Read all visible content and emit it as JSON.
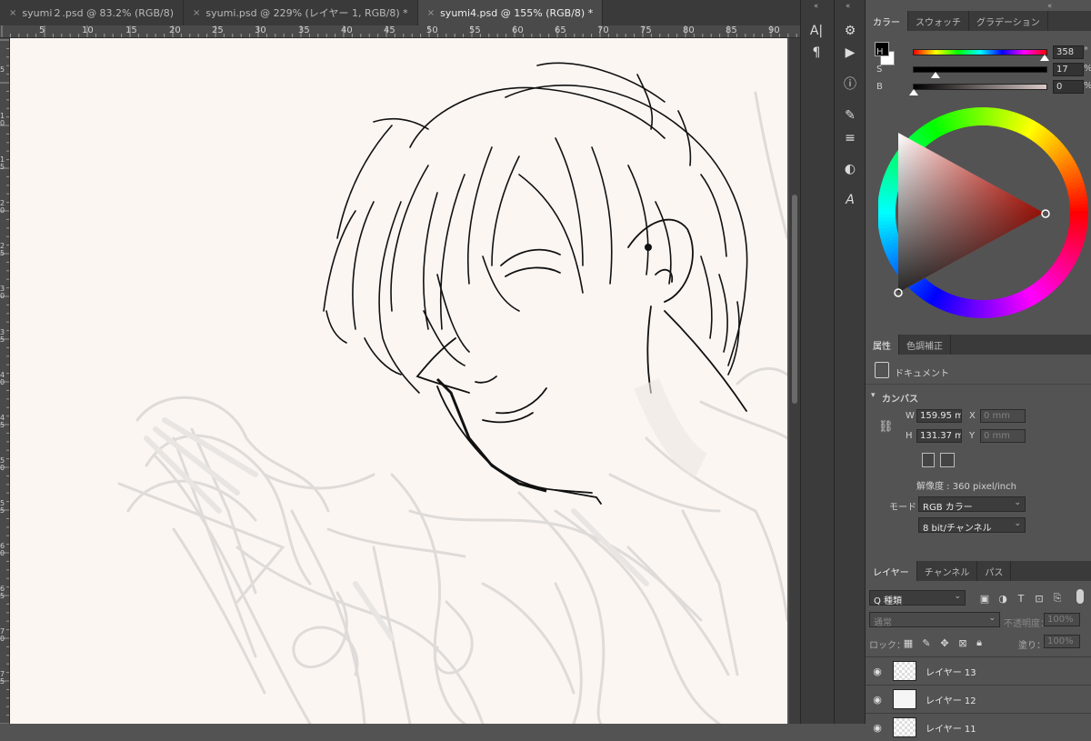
{
  "tabs": [
    {
      "label": "syumi２.psd @ 83.2% (RGB/8)",
      "close": "×",
      "active": false
    },
    {
      "label": "syumi.psd @ 229% (レイヤー 1, RGB/8) *",
      "close": "×",
      "active": false
    },
    {
      "label": "syumi4.psd @ 155% (RGB/8) *",
      "close": "×",
      "active": true
    }
  ],
  "ruler": {
    "top_labels": [
      "5",
      "10",
      "15",
      "20",
      "25",
      "30",
      "35",
      "40",
      "45",
      "50",
      "55",
      "60",
      "65",
      "70",
      "75",
      "80",
      "85",
      "90"
    ],
    "left_labels": [
      "5",
      "1 0",
      "1 5",
      "2 0",
      "2 5",
      "3 0",
      "3 5",
      "4 0",
      "4 5",
      "5 0",
      "5 5",
      "6 0",
      "6 5",
      "7 0",
      "7 5"
    ]
  },
  "color_panel": {
    "tabs": [
      "カラー",
      "スウォッチ",
      "グラデーション"
    ],
    "foreground": "#000000",
    "background": "#ffffff",
    "sliders": [
      {
        "label": "H",
        "value": "358",
        "unit": "°",
        "fraction": 0.994
      },
      {
        "label": "S",
        "value": "17",
        "unit": "%",
        "fraction": 0.17
      },
      {
        "label": "B",
        "value": "0",
        "unit": "%",
        "fraction": 0.0
      }
    ],
    "wheel_hue_color": "#ff1a0a"
  },
  "properties_panel": {
    "tabs": [
      "属性",
      "色調補正"
    ],
    "doc_label": "ドキュメント",
    "section": "カンバス",
    "w_label": "W",
    "w_value": "159.95 mm",
    "h_label": "H",
    "h_value": "131.37 mm",
    "x_label": "X",
    "x_value": "0 mm",
    "y_label": "Y",
    "y_value": "0 mm",
    "resolution": "解像度 : 360 pixel/inch",
    "mode_label": "モード",
    "mode_value": "RGB カラー",
    "depth_value": "8 bit/チャンネル"
  },
  "layers_panel": {
    "tabs": [
      "レイヤー",
      "チャンネル",
      "パス"
    ],
    "filter_label": "Q 種類",
    "blend_mode": "通常",
    "opacity_label": "不透明度：",
    "opacity_value": "100%",
    "lock_label": "ロック：",
    "fill_label": "塗り：",
    "fill_value": "100%",
    "layers": [
      {
        "name": "レイヤー 13"
      },
      {
        "name": "レイヤー 12"
      },
      {
        "name": "レイヤー 11"
      }
    ]
  },
  "toolbar_side": {
    "tools": [
      "character-icon",
      "paragraph-icon",
      "actions-icon",
      "play-icon",
      "info-icon",
      "brush-settings-icon",
      "brush-presets-icon",
      "clone-source-icon",
      "glyphs-icon"
    ]
  }
}
